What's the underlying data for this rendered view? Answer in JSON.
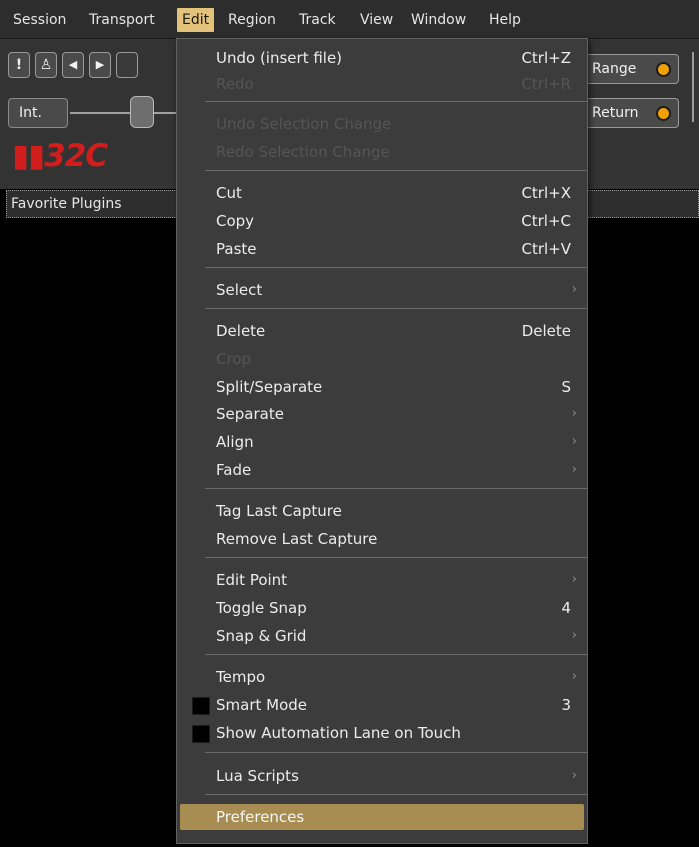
{
  "colors": {
    "menubar_bg": "#2d2d2d",
    "menu_bg": "#3c3c3c",
    "active_menu_highlight": "#e3c27a",
    "item_highlight": "#a78d52",
    "logo_red": "#d21d1d",
    "led_orange": "#f0a000"
  },
  "menubar": {
    "items": [
      {
        "label": "Session"
      },
      {
        "label": "Transport"
      },
      {
        "label": "Edit",
        "active": true
      },
      {
        "label": "Region"
      },
      {
        "label": "Track"
      },
      {
        "label": "View"
      },
      {
        "label": "Window"
      },
      {
        "label": "Help"
      }
    ]
  },
  "toolbar": {
    "buttons": [
      {
        "glyph": "!",
        "icon": "panic-icon"
      },
      {
        "glyph": "♙",
        "icon": "metronome-icon"
      },
      {
        "glyph": "◀",
        "icon": "play-from-start-icon"
      },
      {
        "glyph": "▶",
        "icon": "play-to-end-icon"
      }
    ],
    "int_label": "Int.",
    "logo_text": "▮▮32C",
    "range_label": "Range",
    "return_label": "Return"
  },
  "favorite_plugins": "Favorite Plugins",
  "edit_menu": {
    "items": [
      {
        "label": "Undo (insert file)",
        "shortcut": "Ctrl+Z"
      },
      {
        "label": "Redo",
        "shortcut": "Ctrl+R",
        "disabled": true
      },
      {
        "label": "Undo Selection Change",
        "disabled": true
      },
      {
        "label": "Redo Selection Change",
        "disabled": true
      },
      {
        "label": "Cut",
        "shortcut": "Ctrl+X"
      },
      {
        "label": "Copy",
        "shortcut": "Ctrl+C"
      },
      {
        "label": "Paste",
        "shortcut": "Ctrl+V"
      },
      {
        "label": "Select",
        "submenu": true
      },
      {
        "label": "Delete",
        "shortcut": "Delete"
      },
      {
        "label": "Crop",
        "disabled": true
      },
      {
        "label": "Split/Separate",
        "shortcut": "S"
      },
      {
        "label": "Separate",
        "submenu": true
      },
      {
        "label": "Align",
        "submenu": true
      },
      {
        "label": "Fade",
        "submenu": true
      },
      {
        "label": "Tag Last Capture"
      },
      {
        "label": "Remove Last Capture"
      },
      {
        "label": "Edit Point",
        "submenu": true
      },
      {
        "label": "Toggle Snap",
        "shortcut": "4"
      },
      {
        "label": "Snap & Grid",
        "submenu": true
      },
      {
        "label": "Tempo",
        "submenu": true
      },
      {
        "label": "Smart Mode",
        "shortcut": "3",
        "checkbox": true,
        "checked": false
      },
      {
        "label": "Show Automation Lane on Touch",
        "checkbox": true,
        "checked": false
      },
      {
        "label": "Lua Scripts",
        "submenu": true
      },
      {
        "label": "Preferences",
        "highlighted": true
      }
    ],
    "submenu_arrow": "›"
  }
}
